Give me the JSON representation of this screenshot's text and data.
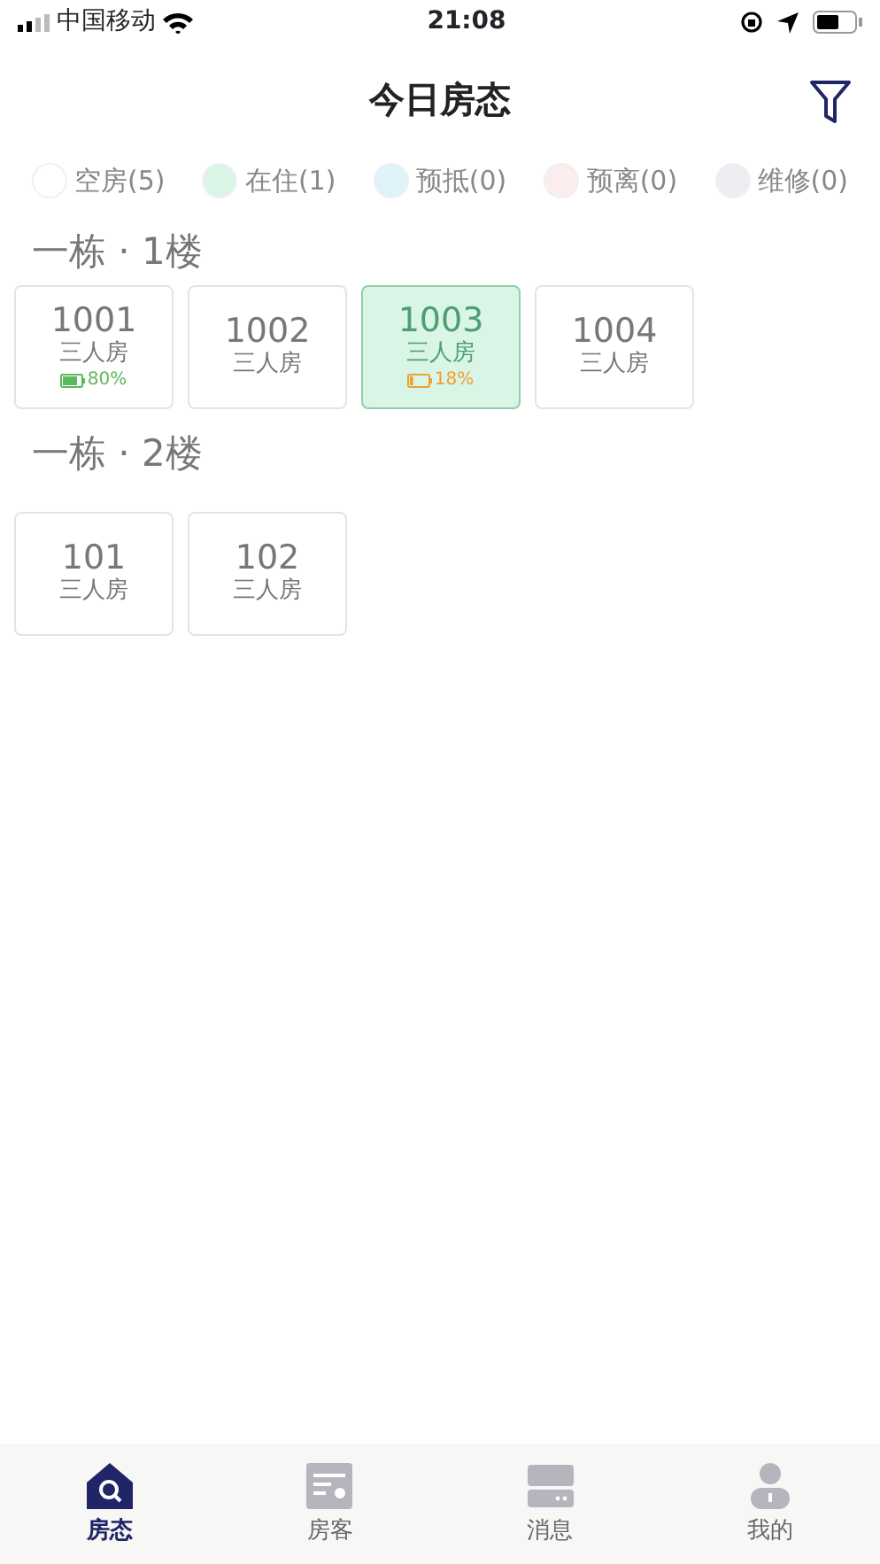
{
  "status_bar": {
    "carrier": "中国移动",
    "time": "21:08"
  },
  "header": {
    "title": "今日房态"
  },
  "legend": [
    {
      "label": "空房(5)",
      "color": "#ffffff"
    },
    {
      "label": "在住(1)",
      "color": "#d9f5e6"
    },
    {
      "label": "预抵(0)",
      "color": "#dff3fa"
    },
    {
      "label": "预离(0)",
      "color": "#fbecee"
    },
    {
      "label": "维修(0)",
      "color": "#eceef2"
    }
  ],
  "floors": [
    {
      "title": "一栋 · 1楼",
      "rooms": [
        {
          "number": "1001",
          "type": "三人房",
          "occupied": false,
          "battery": {
            "level": 0.8,
            "reading": "80%"
          }
        },
        {
          "number": "1002",
          "type": "三人房",
          "occupied": false
        },
        {
          "number": "1003",
          "type": "三人房",
          "occupied": true,
          "battery": {
            "level": 0.18,
            "reading": "18%"
          }
        },
        {
          "number": "1004",
          "type": "三人房",
          "occupied": false
        }
      ]
    },
    {
      "title": "一栋 · 2楼",
      "rooms": [
        {
          "number": "101",
          "type": "三人房",
          "occupied": false
        },
        {
          "number": "102",
          "type": "三人房",
          "occupied": false
        }
      ]
    }
  ],
  "tabs": [
    {
      "label": "房态",
      "kind": "home",
      "selected": true
    },
    {
      "label": "房客",
      "kind": "guests",
      "selected": false
    },
    {
      "label": "消息",
      "kind": "messages",
      "selected": false
    },
    {
      "label": "我的",
      "kind": "profile",
      "selected": false
    }
  ]
}
